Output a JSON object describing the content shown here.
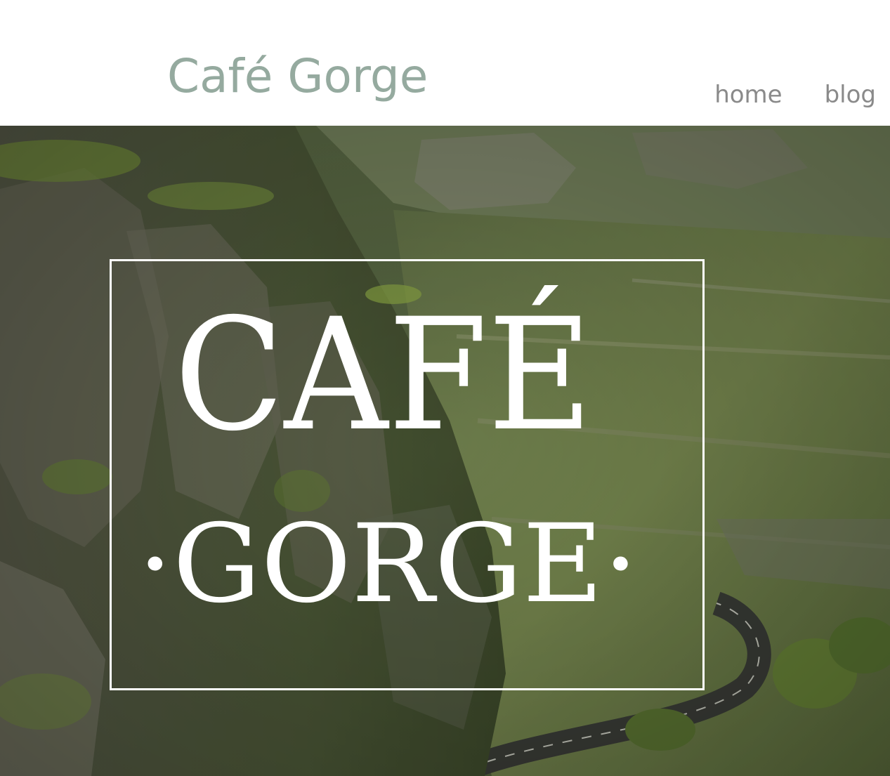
{
  "header": {
    "site_title": "Café Gorge",
    "nav": [
      {
        "label": "home"
      },
      {
        "label": "blog"
      }
    ]
  },
  "hero": {
    "logo_line_1": "CAFÉ",
    "logo_line_2": "·GORGE·",
    "image_subject": "gorge-landscape-photo"
  },
  "colors": {
    "title": "#95aa9f",
    "nav": "#8a8a8a",
    "logo": "#ffffff"
  }
}
